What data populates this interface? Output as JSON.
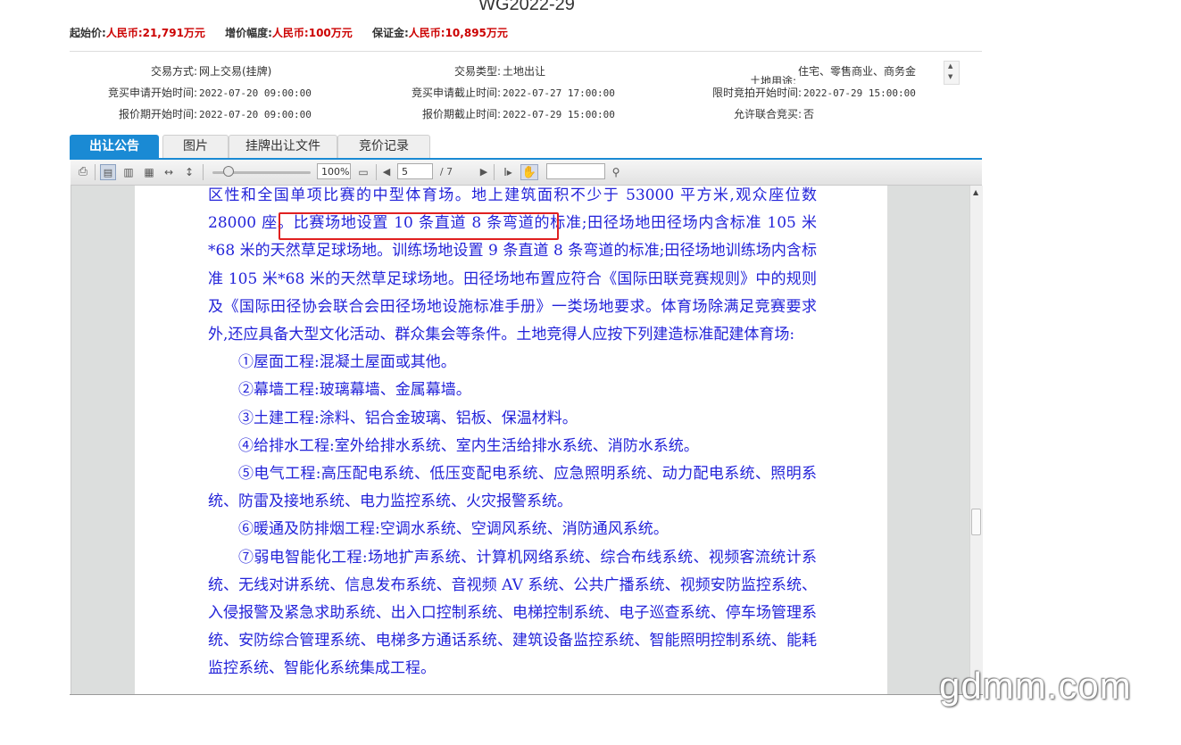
{
  "page": {
    "title": "WG2022-29"
  },
  "price": {
    "start_label": "起始价:",
    "start_value": "人民币:21,791万元",
    "increment_label": "增价幅度:",
    "increment_value": "人民币:100万元",
    "deposit_label": "保证金:",
    "deposit_value": "人民币:10,895万元"
  },
  "info": {
    "trade_method_label": "交易方式:",
    "trade_method_value": "网上交易(挂牌)",
    "trade_type_label": "交易类型:",
    "trade_type_value": "土地出让",
    "land_use_label": "土地用途:",
    "land_use_value": "住宅、零售商业、商务金",
    "apply_start_label": "竞买申请开始时间:",
    "apply_start_value": "2022-07-20 09:00:00",
    "apply_end_label": "竞买申请截止时间:",
    "apply_end_value": "2022-07-27 17:00:00",
    "timed_bid_label": "限时竞拍开始时间:",
    "timed_bid_value": "2022-07-29 15:00:00",
    "quote_start_label": "报价期开始时间:",
    "quote_start_value": "2022-07-20 09:00:00",
    "quote_end_label": "报价期截止时间:",
    "quote_end_value": "2022-07-29 15:00:00",
    "joint_label": "允许联合竞买:",
    "joint_value": "否"
  },
  "tabs": [
    {
      "label": "出让公告",
      "active": true
    },
    {
      "label": "图片",
      "active": false
    },
    {
      "label": "挂牌出让文件",
      "active": false
    },
    {
      "label": "竞价记录",
      "active": false
    }
  ],
  "toolbar": {
    "zoom": "100%",
    "page_current": "5",
    "page_total": "/ 7",
    "search_value": ""
  },
  "document": {
    "paragraphs": [
      "区性和全国单项比赛的中型体育场。地上建筑面积不少于 53000 平方米,观众座位数 28000 座。比赛场地设置 10 条直道 8 条弯道的标准;田径场地田径场内含标准 105 米*68 米的天然草足球场地。训练场地设置 9 条直道 8 条弯道的标准;田径场地训练场内含标准 105 米*68 米的天然草足球场地。田径场地布置应符合《国际田联竞赛规则》中的规则及《国际田径协会联合会田径场地设施标准手册》一类场地要求。体育场除满足竞赛要求外,还应具备大型文化活动、群众集会等条件。土地竞得人应按下列建造标准配建体育场:",
      "①屋面工程:混凝土屋面或其他。",
      "②幕墙工程:玻璃幕墙、金属幕墙。",
      "③土建工程:涂料、铝合金玻璃、铝板、保温材料。",
      "④给排水工程:室外给排水系统、室内生活给排水系统、消防水系统。",
      "⑤电气工程:高压配电系统、低压变配电系统、应急照明系统、动力配电系统、照明系统、防雷及接地系统、电力监控系统、火灾报警系统。",
      "⑥暖通及防排烟工程:空调水系统、空调风系统、消防通风系统。",
      "⑦弱电智能化工程:场地扩声系统、计算机网络系统、综合布线系统、视频客流统计系统、无线对讲系统、信息发布系统、音视频 AV 系统、公共广播系统、视频安防监控系统、入侵报警及紧急求助系统、出入口控制系统、电梯控制系统、电子巡查系统、停车场管理系统、安防综合管理系统、电梯多方通话系统、建筑设备监控系统、智能照明控制系统、能耗监控系统、智能化系统集成工程。"
    ]
  },
  "watermark": "gdmm.com",
  "colors": {
    "accent": "#1a8ad4",
    "price_red": "#cc0000",
    "doc_text": "#2323d9",
    "highlight_box": "#e02020"
  }
}
